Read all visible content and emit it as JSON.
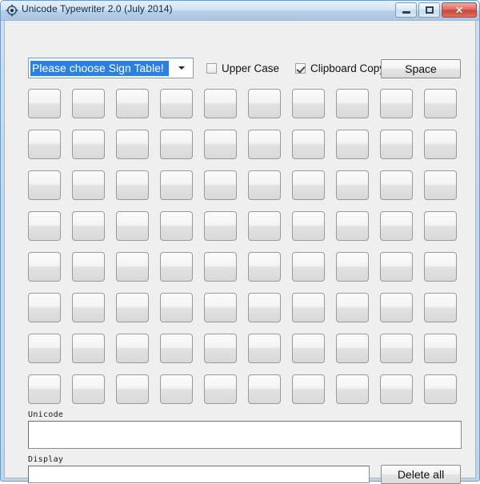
{
  "window": {
    "title": "Unicode Typewriter 2.0 (July 2014)",
    "icon": "app-gear-icon",
    "controls": {
      "minimize_label": "",
      "maximize_label": "",
      "close_label": "✕"
    },
    "frame_color": "#bed5ec",
    "client_bg": "#efefef"
  },
  "toolbar": {
    "sign_table_select": {
      "selected": "Please choose Sign Table!",
      "selected_highlight_color": "#2f7fe0",
      "arrow_icon": "chevron-down-icon",
      "options": [
        "Please choose Sign Table!"
      ]
    },
    "upper_case": {
      "label": "Upper Case",
      "checked": false
    },
    "clipboard_copy": {
      "label": "Clipboard Copy",
      "checked": true
    },
    "space_button": {
      "label": "Space"
    }
  },
  "sign_grid": {
    "rows": 8,
    "columns": 10,
    "buttons": [
      "",
      "",
      "",
      "",
      "",
      "",
      "",
      "",
      "",
      "",
      "",
      "",
      "",
      "",
      "",
      "",
      "",
      "",
      "",
      "",
      "",
      "",
      "",
      "",
      "",
      "",
      "",
      "",
      "",
      "",
      "",
      "",
      "",
      "",
      "",
      "",
      "",
      "",
      "",
      "",
      "",
      "",
      "",
      "",
      "",
      "",
      "",
      "",
      "",
      "",
      "",
      "",
      "",
      "",
      "",
      "",
      "",
      "",
      "",
      "",
      "",
      "",
      "",
      "",
      "",
      "",
      "",
      "",
      "",
      "",
      "",
      "",
      "",
      "",
      "",
      "",
      "",
      "",
      "",
      ""
    ]
  },
  "fields": {
    "unicode": {
      "label": "Unicode",
      "value": "",
      "placeholder": ""
    },
    "display": {
      "label": "Display",
      "value": "",
      "placeholder": ""
    }
  },
  "actions": {
    "delete_all_label": "Delete all"
  }
}
